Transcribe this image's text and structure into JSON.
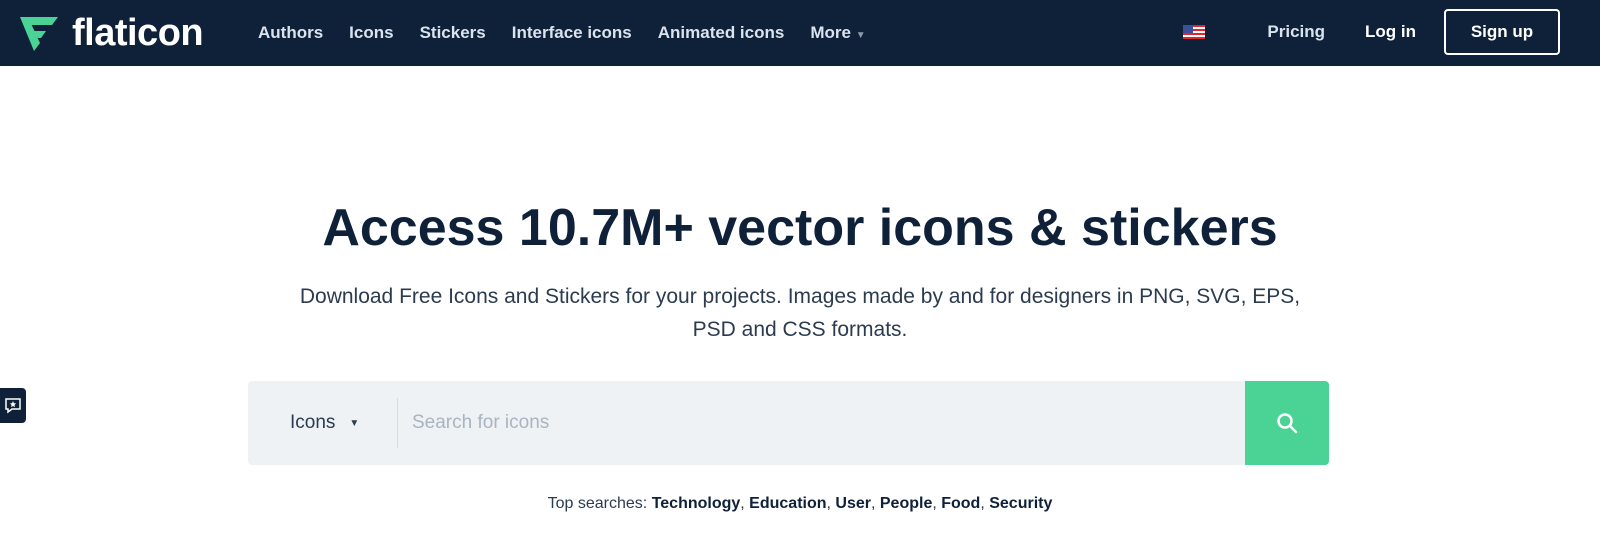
{
  "brand": {
    "name": "flaticon",
    "color": "#4ad395"
  },
  "nav": {
    "links": [
      "Authors",
      "Icons",
      "Stickers",
      "Interface icons",
      "Animated icons",
      "More"
    ],
    "pricing": "Pricing",
    "login": "Log in",
    "signup": "Sign up",
    "language_flag": "us-flag-icon"
  },
  "hero": {
    "title": "Access 10.7M+ vector icons & stickers",
    "subtitle": "Download Free Icons and Stickers for your projects. Images made by and for designers in PNG, SVG, EPS, PSD and CSS formats."
  },
  "search": {
    "type": "Icons",
    "placeholder": "Search for icons"
  },
  "top_searches": {
    "label": "Top searches:",
    "items": [
      "Technology",
      "Education",
      "User",
      "People",
      "Food",
      "Security"
    ]
  }
}
